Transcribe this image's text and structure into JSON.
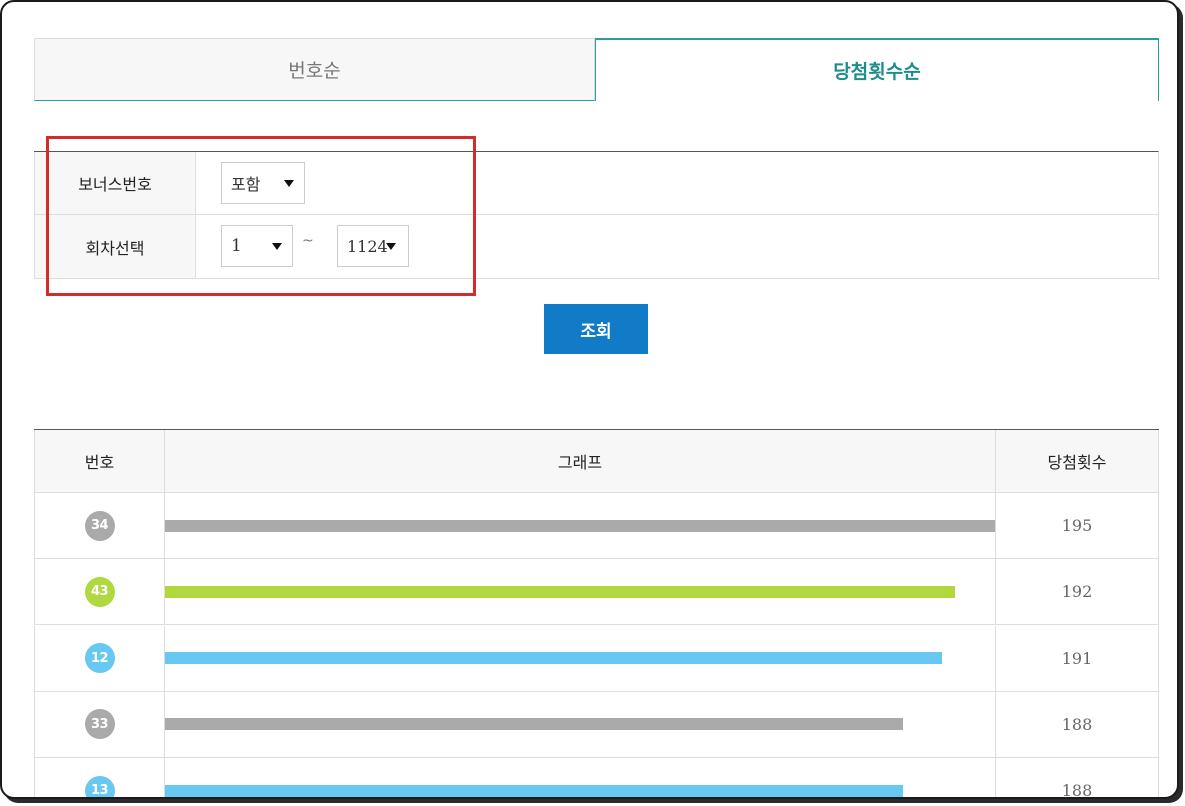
{
  "tabs": [
    {
      "label": "번호순",
      "active": false
    },
    {
      "label": "당첨횟수순",
      "active": true
    }
  ],
  "filter": {
    "bonus_label": "보너스번호",
    "bonus_value": "포함",
    "round_label": "회차선택",
    "round_from": "1",
    "round_sep": "~",
    "round_to": "1124"
  },
  "search_button": "조회",
  "results": {
    "headers": {
      "number": "번호",
      "graph": "그래프",
      "count": "당첨횟수"
    },
    "max_count": 195,
    "rows": [
      {
        "number": "34",
        "count": 195,
        "color": "#aaaaaa"
      },
      {
        "number": "43",
        "count": 192,
        "color": "#b0d840"
      },
      {
        "number": "12",
        "count": 191,
        "color": "#69c8f2"
      },
      {
        "number": "33",
        "count": 188,
        "color": "#aaaaaa"
      },
      {
        "number": "13",
        "count": 188,
        "color": "#69c8f2"
      }
    ]
  },
  "colors": {
    "accent": "#2a9d9d",
    "button": "#127bc8",
    "highlight": "#d42b2b"
  }
}
